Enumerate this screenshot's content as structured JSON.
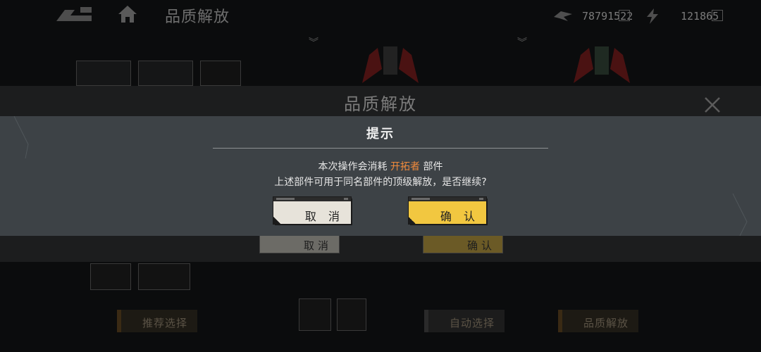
{
  "background": {
    "title": "品质解放",
    "currency1_value": "78791522",
    "currency2_value": "121865",
    "panel_title": "品质解放",
    "cancel_label": "取消",
    "confirm_label": "确认",
    "bottom_buttons": [
      "推荐选择",
      "自动选择",
      "品质解放"
    ]
  },
  "dialog": {
    "title": "提示",
    "line1_prefix": "本次操作会消耗 ",
    "line1_highlight": "开拓者",
    "line1_suffix": " 部件",
    "line2": "上述部件可用于同名部件的顶级解放，是否继续?",
    "cancel_label": "取 消",
    "confirm_label": "确 认",
    "highlight_color": "#f08a3c",
    "confirm_color": "#f2c740"
  }
}
